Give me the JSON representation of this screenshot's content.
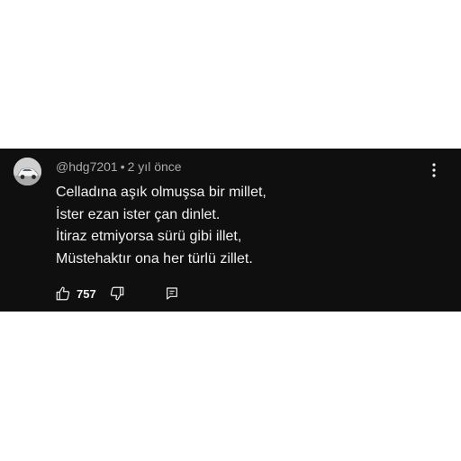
{
  "comment": {
    "handle": "@hdg7201",
    "separator": "•",
    "time": "2 yıl önce",
    "lines": [
      "Celladına aşık olmuşsa bir millet,",
      "İster ezan ister çan dinlet.",
      "İtiraz etmiyorsa sürü gibi illet,",
      "Müstehaktır ona her türlü zillet."
    ],
    "like_count": "757"
  },
  "icons": {
    "avatar": "car-avatar",
    "more": "more-vert-icon",
    "like": "thumbs-up-icon",
    "dislike": "thumbs-down-icon",
    "reply": "reply-icon"
  },
  "colors": {
    "card_background": "#0f0f0f",
    "text_primary": "#f1f1f1",
    "text_secondary": "#aaaaaa"
  }
}
